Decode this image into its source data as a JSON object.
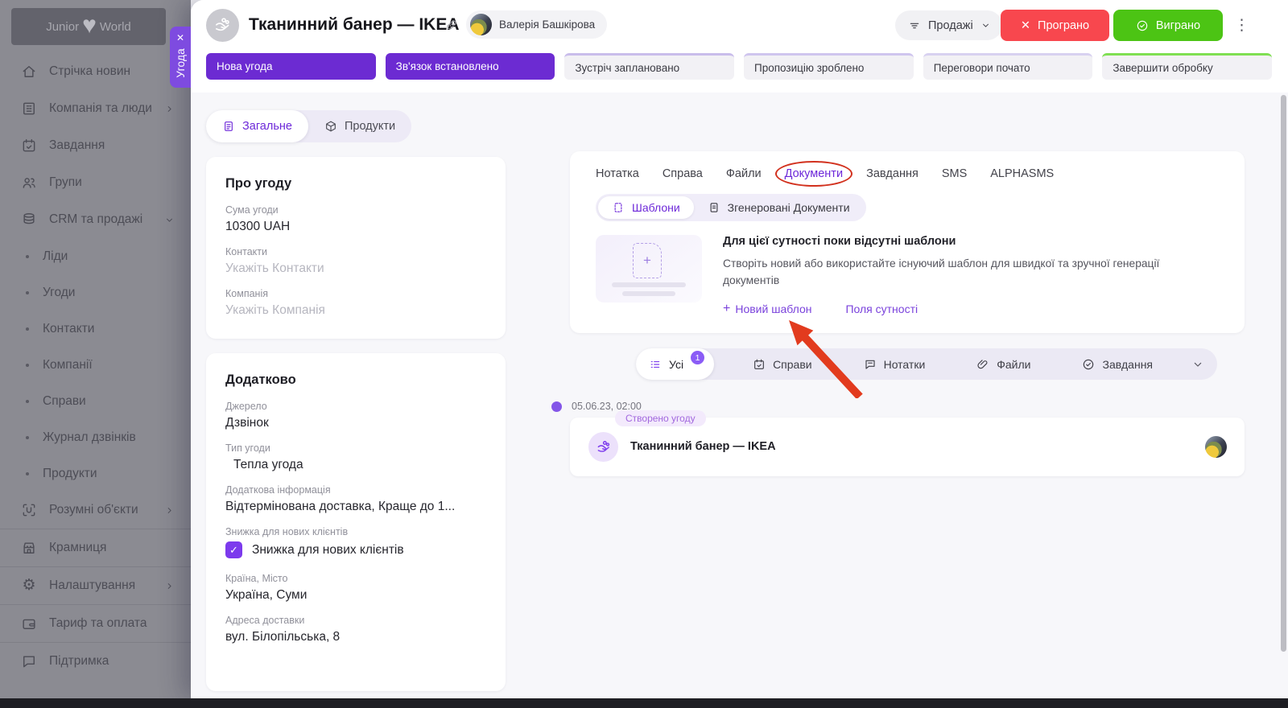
{
  "icons": {
    "close": "✕",
    "dots": "⋮",
    "plus": "+",
    "check": "✓",
    "gear": "⚙",
    "heart": "♥"
  },
  "colors": {
    "accent_purple": "#6d28d9",
    "stage_purple": "#6c2bd2",
    "lost_red": "#f8474e",
    "won_green": "#4cc414",
    "annotation_red": "#d2311e"
  },
  "drawer_tab": {
    "label": "Угода"
  },
  "sidebar": {
    "logo_left": "Junior",
    "logo_right": "World",
    "items": [
      {
        "label": "Стрічка новин"
      },
      {
        "label": "Компанія та люди"
      },
      {
        "label": "Завдання"
      },
      {
        "label": "Групи"
      },
      {
        "label": "CRM та продажі"
      }
    ],
    "sub_items": [
      "Ліди",
      "Угоди",
      "Контакти",
      "Компанії",
      "Справи",
      "Журнал дзвінків",
      "Продукти"
    ],
    "bottom_items": [
      {
        "label": "Розумні об'єкти"
      },
      {
        "label": "Крамниця"
      },
      {
        "label": "Налаштування"
      },
      {
        "label": "Тариф та оплата"
      },
      {
        "label": "Підтримка"
      }
    ]
  },
  "header": {
    "title": "Тканинний банер — IKEA",
    "manager": "Валерія Башкірова",
    "pipeline": "Продажі",
    "lost": "Програно",
    "won": "Виграно"
  },
  "stages": [
    "Нова угода",
    "Зв'язок встановлено",
    "Зустріч заплановано",
    "Пропозицію зроблено",
    "Переговори почато",
    "Завершити обробку"
  ],
  "view_tabs": {
    "general": "Загальне",
    "products": "Продукти"
  },
  "about_card": {
    "title": "Про угоду",
    "amount_label": "Сума угоди",
    "amount_value": "10300 UAH",
    "contacts_label": "Контакти",
    "contacts_placeholder": "Укажіть Контакти",
    "company_label": "Компанія",
    "company_placeholder": "Укажіть Компанія"
  },
  "extra_card": {
    "title": "Додатково",
    "source_label": "Джерело",
    "source_value": "Дзвінок",
    "type_label": "Тип угоди",
    "type_value": "Тепла угода",
    "info_label": "Додаткова інформація",
    "info_value": "Відтермінована доставка, Краще до 1...",
    "discount_label": "Знижка для нових клієнтів",
    "discount_checkbox_label": "Знижка для нових клієнтів",
    "location_label": "Країна, Місто",
    "location_value": "Україна, Суми",
    "address_label": "Адреса доставки",
    "address_value": "вул. Білопільська, 8"
  },
  "activity_tabs": [
    "Нотатка",
    "Справа",
    "Файли",
    "Документи",
    "Завдання",
    "SMS",
    "ALPHASMS"
  ],
  "doc_tabs": {
    "templates": "Шаблони",
    "generated": "Згенеровані Документи"
  },
  "empty_state": {
    "title": "Для цієї сутності поки відсутні шаблони",
    "description": "Створіть новий або використайте існуючий шаблон для швидкої та зручної генерації документів",
    "new_template": "Новий шаблон",
    "entity_fields": "Поля сутності"
  },
  "filter_bar": {
    "all": "Усі",
    "all_badge": "1",
    "cases": "Справи",
    "notes": "Нотатки",
    "files": "Файли",
    "tasks": "Завдання"
  },
  "timeline": {
    "date": "05.06.23, 02:00",
    "event_badge": "Створено угоду",
    "event_title": "Тканинний банер — IKEA"
  }
}
